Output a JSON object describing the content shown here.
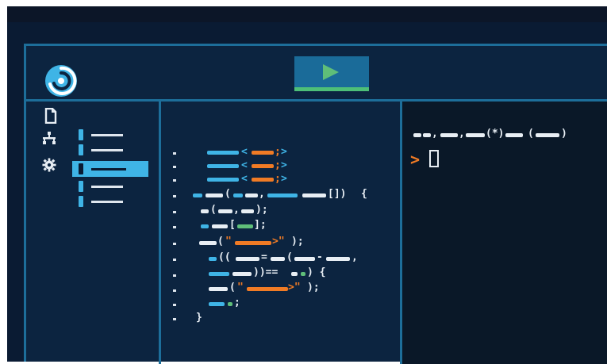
{
  "app": {
    "name": ""
  },
  "toolbar": {
    "run_icon": "play-icon",
    "logo_icon": "swirl-logo-icon"
  },
  "sidebar": {
    "icons": [
      "file-icon",
      "hierarchy-icon",
      "gear-icon"
    ],
    "tree_items": [
      {
        "active": false
      },
      {
        "active": false
      },
      {
        "active": true
      },
      {
        "active": false
      },
      {
        "active": false
      }
    ]
  },
  "editor": {
    "line_count": 12,
    "brace_open": "{",
    "brace_close": "}"
  },
  "terminal": {
    "prompt": ">"
  },
  "colors": {
    "background": "#0a1b33",
    "panel": "#0c2440",
    "border": "#1d6e9a",
    "accent_blue": "#3fb4e6",
    "accent_orange": "#f07b25",
    "accent_green": "#5fbe79",
    "text": "#e8eef4"
  }
}
